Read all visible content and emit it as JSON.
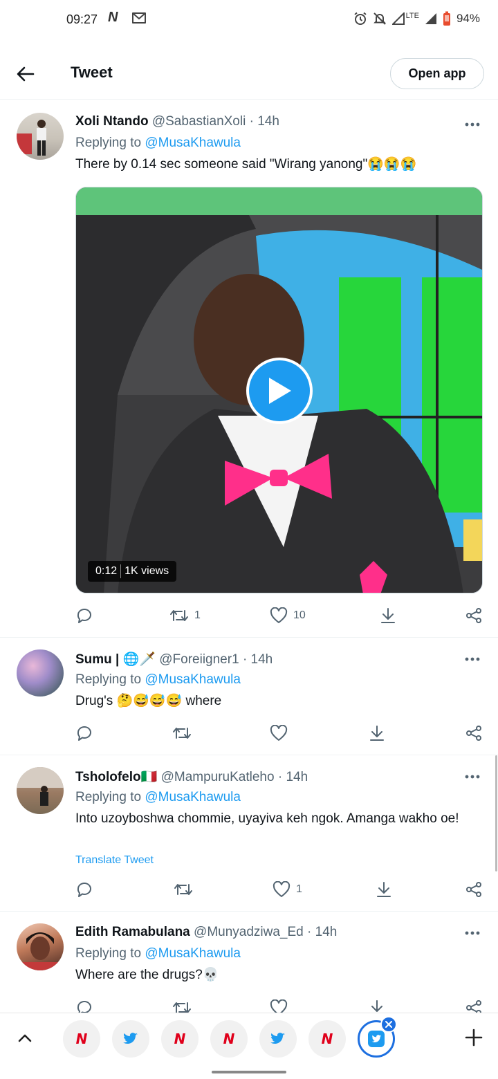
{
  "status_bar": {
    "time": "09:27",
    "network_logo": "N",
    "battery": "94%",
    "lte": "LTE"
  },
  "header": {
    "title": "Tweet",
    "open_app": "Open app"
  },
  "tweets": [
    {
      "name": "Xoli Ntando",
      "handle": "@SabastianXoli",
      "dot": "·",
      "time": "14h",
      "replying_label": "Replying to",
      "replying_to": "@MusaKhawula",
      "text": "There by 0.14 sec someone said \"Wirang yanong\"😭😭😭",
      "video": {
        "duration": "0:12",
        "views": "1K views"
      },
      "retweets": "1",
      "likes": "10"
    },
    {
      "name": "Sumu | 🌐🗡️",
      "handle": "@Foreiigner1",
      "dot": "·",
      "time": "14h",
      "replying_label": "Replying to",
      "replying_to": "@MusaKhawula",
      "text": "Drug's 🤔😅😅😅 where"
    },
    {
      "name": "Tsholofelo🇮🇹",
      "handle": "@MampuruKatleho",
      "dot": "·",
      "time": "14h",
      "replying_label": "Replying to",
      "replying_to": "@MusaKhawula",
      "text": "Into uzoyboshwa chommie, uyayiva keh ngok. Amanga wakho oe!",
      "translate": "Translate Tweet",
      "likes": "1"
    },
    {
      "name": "Edith Ramabulana",
      "handle": "@Munyadziwa_Ed",
      "dot": "·",
      "time": "14h",
      "replying_label": "Replying to",
      "replying_to": "@MusaKhawula",
      "text": "Where are the drugs?💀"
    }
  ],
  "bottom_bar": {
    "tabs": [
      "ntv",
      "twitter",
      "ntv",
      "ntv",
      "twitter",
      "ntv",
      "twitter-active"
    ],
    "ntv_logo": "N"
  },
  "colors": {
    "accent": "#1d9bf0",
    "muted": "#536471",
    "tab_active": "#1d6fe0",
    "ntv_red": "#e0001b"
  }
}
